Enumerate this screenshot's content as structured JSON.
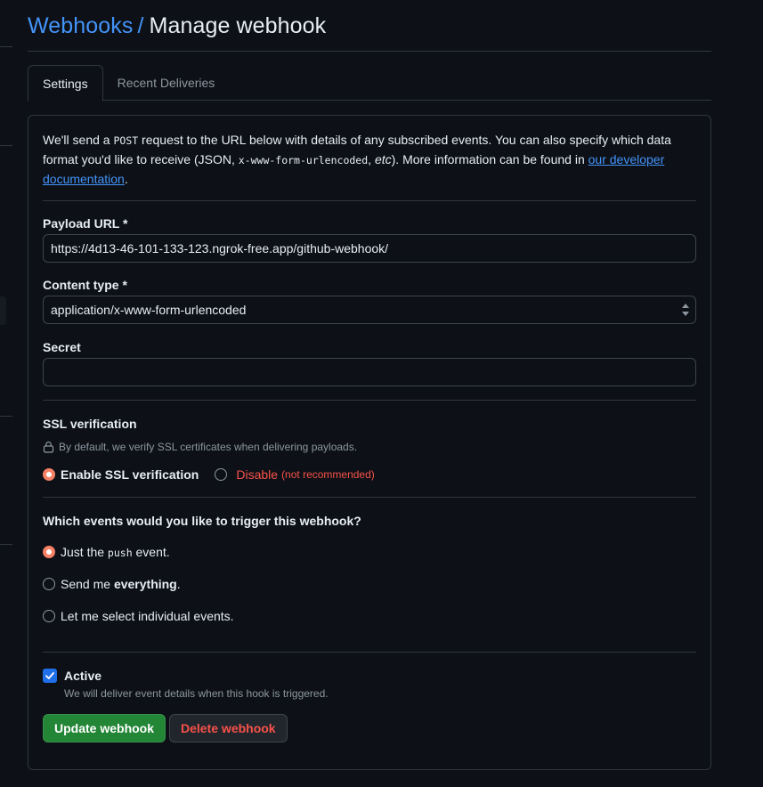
{
  "breadcrumb": {
    "parent": "Webhooks",
    "separator": "/",
    "current": "Manage webhook"
  },
  "tabs": [
    {
      "label": "Settings",
      "active": true
    },
    {
      "label": "Recent Deliveries",
      "active": false
    }
  ],
  "intro": {
    "part1": "We'll send a ",
    "method": "POST",
    "part2": " request to the URL below with details of any subscribed events. You can also specify which data format you'd like to receive (JSON, ",
    "format": "x-www-form-urlencoded",
    "part3": ", ",
    "etc": "etc",
    "part4": "). More information can be found in ",
    "link": "our developer documentation",
    "part5": "."
  },
  "payload_url": {
    "label": "Payload URL *",
    "value": "https://4d13-46-101-133-123.ngrok-free.app/github-webhook/"
  },
  "content_type": {
    "label": "Content type *",
    "value": "application/x-www-form-urlencoded"
  },
  "secret": {
    "label": "Secret",
    "value": ""
  },
  "ssl": {
    "title": "SSL verification",
    "note": "By default, we verify SSL certificates when delivering payloads.",
    "enable_label": "Enable SSL verification",
    "disable_label": "Disable",
    "disable_note": "(not recommended)",
    "selected": "enable"
  },
  "events": {
    "title": "Which events would you like to trigger this webhook?",
    "option1_pre": "Just the ",
    "option1_code": "push",
    "option1_post": " event.",
    "option2_pre": "Send me ",
    "option2_bold": "everything",
    "option2_post": ".",
    "option3": "Let me select individual events.",
    "selected": "push"
  },
  "active": {
    "label": "Active",
    "description": "We will deliver event details when this hook is triggered.",
    "checked": true
  },
  "buttons": {
    "update": "Update webhook",
    "delete": "Delete webhook"
  },
  "colors": {
    "accent_blue": "#4493f8",
    "radio_selected": "#f78166",
    "danger": "#f85149",
    "primary_green": "#238636",
    "checkbox_blue": "#1f6feb"
  }
}
